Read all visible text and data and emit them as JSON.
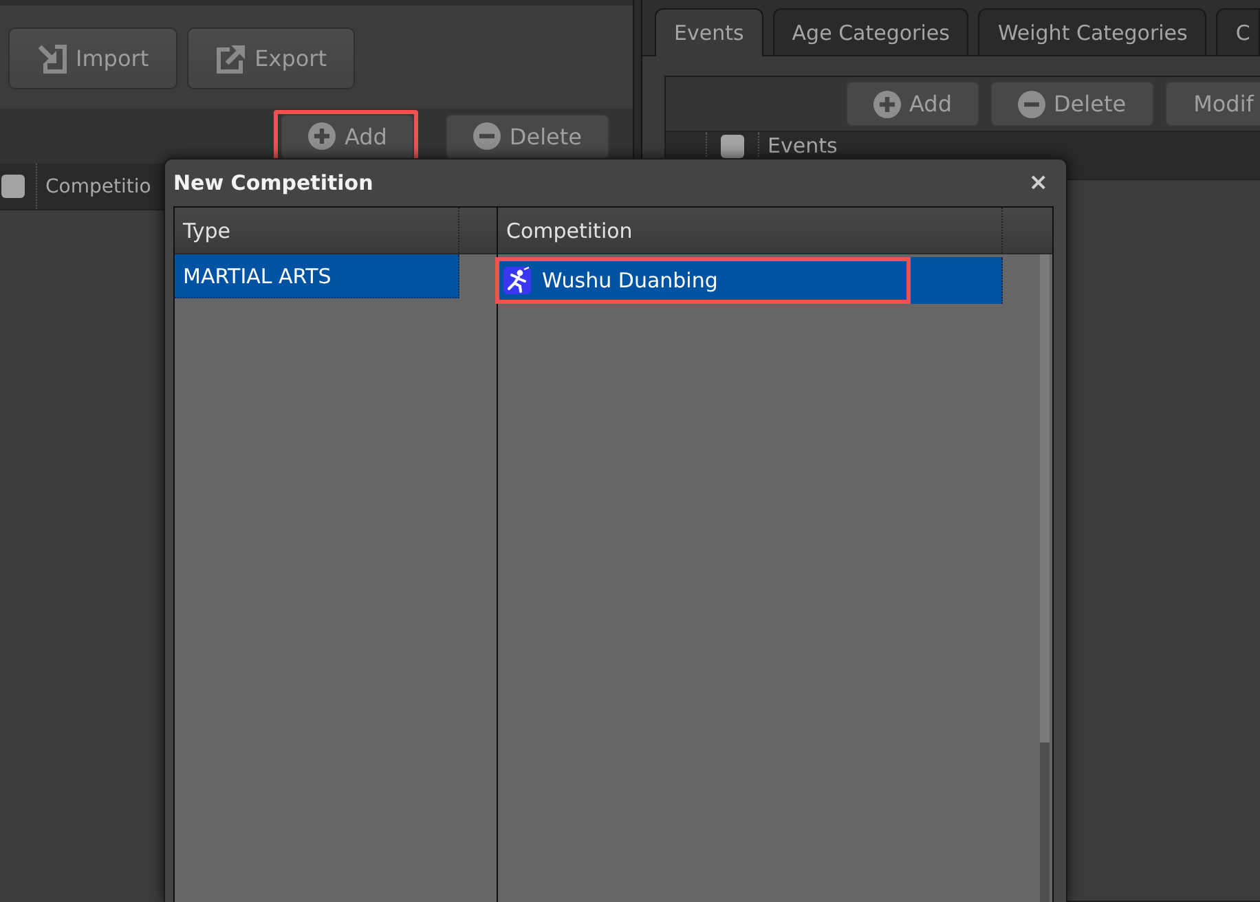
{
  "left_panel": {
    "toolbar": [
      {
        "kind": "import",
        "label": "Import"
      },
      {
        "kind": "export",
        "label": "Export"
      }
    ],
    "actions": [
      {
        "kind": "add",
        "label": "Add",
        "highlighted": true
      },
      {
        "kind": "delete",
        "label": "Delete",
        "highlighted": false
      }
    ],
    "grid": {
      "select_all": {
        "checked": false
      },
      "columns": [
        "Competitio"
      ]
    }
  },
  "right_panel": {
    "tabs": [
      {
        "label": "Events",
        "selected": true
      },
      {
        "label": "Age Categories",
        "selected": false
      },
      {
        "label": "Weight Categories",
        "selected": false
      },
      {
        "label": "C",
        "selected": false
      }
    ],
    "actions": [
      {
        "kind": "add",
        "label": "Add",
        "highlighted": false
      },
      {
        "kind": "delete",
        "label": "Delete",
        "highlighted": false
      },
      {
        "kind": "modify",
        "label": "Modif",
        "highlighted": false
      }
    ],
    "grid": {
      "select_all": {
        "checked": false
      },
      "columns": [
        "Events"
      ]
    }
  },
  "dialog": {
    "title": "New Competition",
    "close": "×",
    "type_list": {
      "header": "Type",
      "rows": [
        {
          "label": "MARTIAL ARTS",
          "selected": true
        }
      ]
    },
    "competition_list": {
      "header": "Competition",
      "rows": [
        {
          "label": "Wushu Duanbing",
          "selected": true,
          "highlighted": true
        }
      ]
    }
  }
}
